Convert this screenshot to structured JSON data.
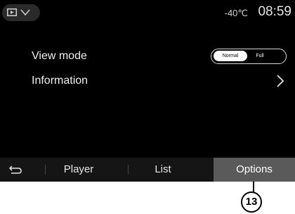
{
  "status_bar": {
    "source_icon": "media-source-icon",
    "dropdown_icon": "chevron-down-icon",
    "temperature": "-40℃",
    "time": "08:59"
  },
  "settings": {
    "view_mode": {
      "label": "View mode",
      "options": [
        "Normal",
        "Full"
      ],
      "selected": "Normal"
    },
    "information": {
      "label": "Information",
      "icon": "chevron-right-icon"
    }
  },
  "bottom_bar": {
    "back_icon": "back-arrow-icon",
    "tabs": [
      "Player",
      "List",
      "Options"
    ],
    "active_tab": "Options"
  },
  "callout": {
    "number": "13"
  },
  "colors": {
    "screen_bg": "#000000",
    "active_tab_bg": "#5a5a5a",
    "bottom_bar_bg": "#151515",
    "text": "#f0f0f0"
  }
}
